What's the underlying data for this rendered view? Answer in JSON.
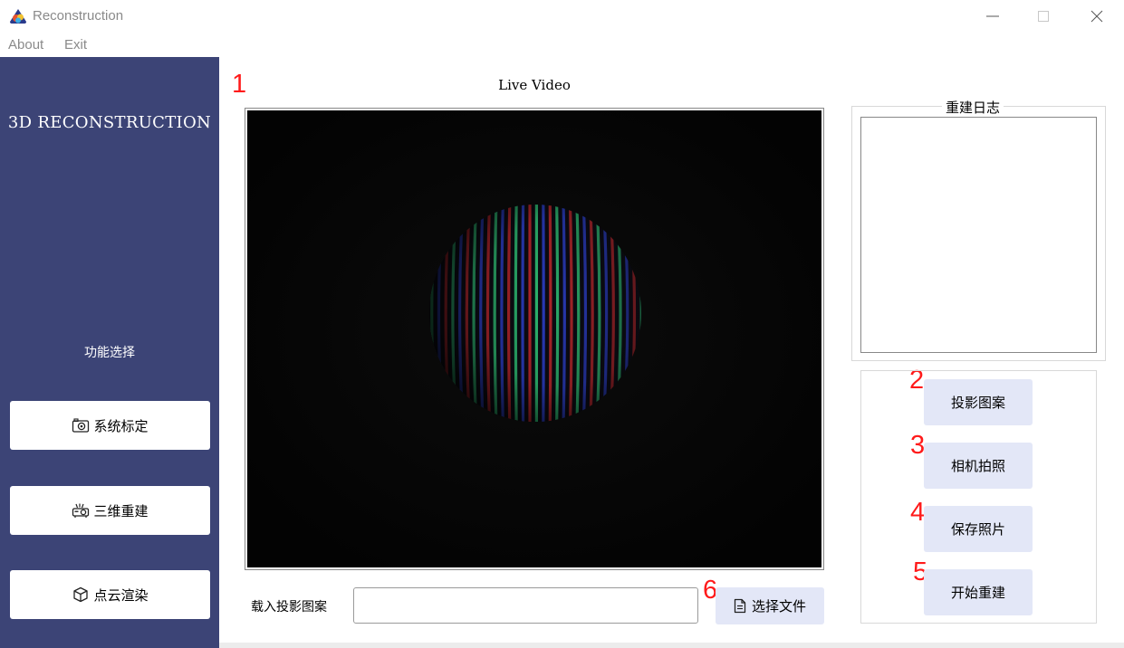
{
  "window": {
    "title": "Reconstruction",
    "controls": [
      "minimize-icon",
      "maximize-icon",
      "close-icon"
    ]
  },
  "menu": {
    "about": "About",
    "exit": "Exit"
  },
  "sidebar": {
    "brand": "3D RECONSTRUCTION",
    "function_label": "功能选择",
    "buttons": [
      {
        "label": "系统标定",
        "icon": "camera-icon"
      },
      {
        "label": "三维重建",
        "icon": "projector-icon"
      },
      {
        "label": "点云渲染",
        "icon": "cube-icon"
      }
    ],
    "bg_color": "#3c4476"
  },
  "main": {
    "video_title": "Live Video",
    "load_label": "载入投影图案",
    "file_input_value": "",
    "choose_file_label": "选择文件",
    "choose_file_icon": "document-icon"
  },
  "log": {
    "title": "重建日志",
    "content": ""
  },
  "actions": [
    {
      "label": "投影图案"
    },
    {
      "label": "相机拍照"
    },
    {
      "label": "保存照片"
    },
    {
      "label": "开始重建"
    }
  ],
  "annotations": [
    "1",
    "2",
    "3",
    "4",
    "5",
    "6"
  ],
  "colors": {
    "annotation": "#ff1a1a",
    "button_bg": "#e3e7f7",
    "stripe_red": "#c0282c",
    "stripe_green": "#2fbf74",
    "stripe_blue": "#2c3fc8"
  }
}
